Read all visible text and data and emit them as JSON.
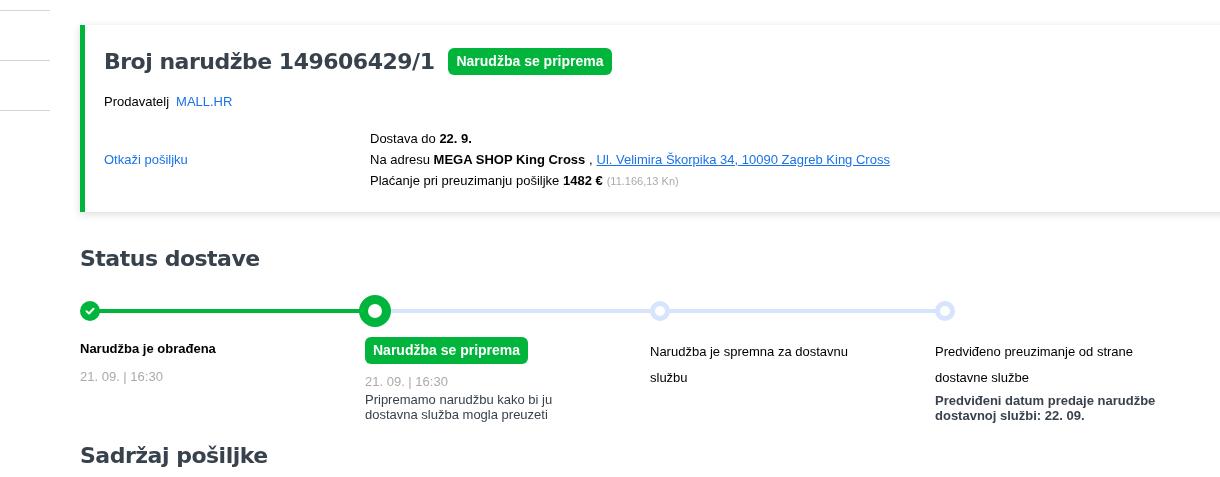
{
  "order": {
    "title": "Broj narudžbe 149606429/1",
    "status_badge": "Narudžba se priprema",
    "seller_label": "Prodavatelj",
    "seller_link": "MALL.HR",
    "cancel_link": "Otkaži pošiljku",
    "delivery_lines": [
      {
        "text": "Dostava do **22. 9.**"
      },
      {
        "text": "Na adresu **MEGA SHOP King Cross** ,",
        "link": "Ul. Velimira Škorpika 34, 10090 Zagreb King Cross"
      },
      {
        "text": "Plaćanje pri preuzimanju pošiljke **1482 €**",
        "note": "(11.166,13 Kn)"
      }
    ]
  },
  "delivery_status": {
    "title": "Status dostave",
    "steps": [
      {
        "completed": true,
        "current": false,
        "title": "Narudžba je obrađena",
        "time": "21. 09. | 16:30"
      },
      {
        "completed": true,
        "current": true,
        "title": "Narudžba se priprema",
        "time": "21. 09. | 16:30",
        "description": "Pripremamo narudžbu kako bi ju dostavna služba mogla preuzeti"
      },
      {
        "completed": false,
        "current": false,
        "title": "Narudžba je spremna za dostavnu službu"
      },
      {
        "completed": false,
        "current": false,
        "title": "Predviđeno preuzimanje od strane dostavne službe",
        "note": "Predviđeni datum predaje narudžbe dostavnoj službi: 22. 09."
      }
    ]
  },
  "next_section": {
    "title": "Sadržaj pošiljke"
  }
}
